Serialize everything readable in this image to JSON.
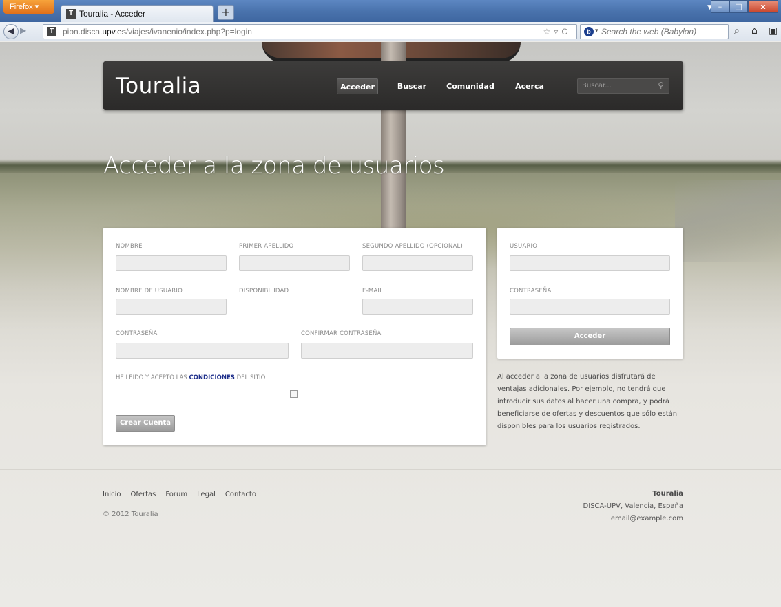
{
  "browser": {
    "app_button": "Firefox",
    "tab_title": "Touralia - Acceder",
    "tab_favicon": "T",
    "new_tab": "+",
    "url_prefix": "pion.disca.",
    "url_domain": "upv.es",
    "url_path": "/viajes/ivanenio/index.php?p=login",
    "search_placeholder": "Search the web (Babylon)"
  },
  "site": {
    "logo": "Touralia",
    "menu": [
      {
        "label": "Acceder",
        "active": true
      },
      {
        "label": "Buscar",
        "active": false
      },
      {
        "label": "Comunidad",
        "active": false
      },
      {
        "label": "Acerca",
        "active": false
      }
    ],
    "search_placeholder": "Buscar..."
  },
  "hero": {
    "title": "Acceder a la zona de usuarios"
  },
  "register": {
    "labels": {
      "nombre": "NOMBRE",
      "primer_apellido": "PRIMER APELLIDO",
      "segundo_apellido": "SEGUNDO APELLIDO (OPCIONAL)",
      "usuario": "NOMBRE DE USUARIO",
      "disponibilidad": "DISPONIBILIDAD",
      "email": "E-MAIL",
      "password": "CONTRASEÑA",
      "confirm": "CONFIRMAR CONTRASEÑA"
    },
    "accept_pre": "HE LEÍDO Y ACEPTO LAS ",
    "accept_link": "CONDICIONES",
    "accept_post": " DEL SITIO",
    "accepted": false,
    "submit": "Crear Cuenta"
  },
  "login": {
    "user_label": "USUARIO",
    "pass_label": "CONTRASEÑA",
    "submit": "Acceder",
    "info": "Al acceder a la zona de usuarios disfrutará de ventajas adicionales. Por ejemplo, no tendrá que introducir sus datos al hacer una compra, y podrá beneficiarse de ofertas y descuentos que sólo están disponibles para los usuarios registrados."
  },
  "footer": {
    "links": [
      "Inicio",
      "Ofertas",
      "Forum",
      "Legal",
      "Contacto"
    ],
    "copyright": "© 2012 Touralia",
    "brand": "Touralia",
    "address": "DISCA-UPV, Valencia, España",
    "email": "email@example.com"
  }
}
